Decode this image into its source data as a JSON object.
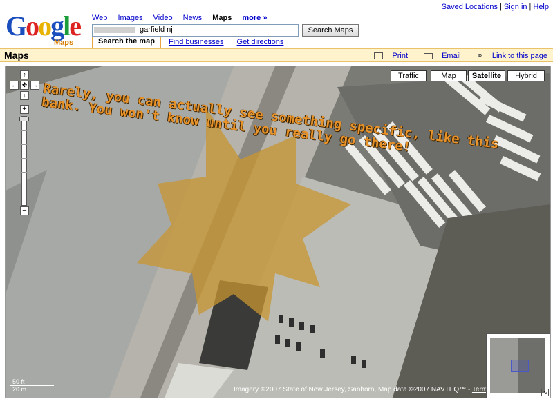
{
  "header": {
    "top_links": [
      "Saved Locations",
      "Sign in",
      "Help"
    ],
    "logo_text": "Google",
    "logo_sub": "Maps",
    "nav": [
      {
        "label": "Web",
        "active": false
      },
      {
        "label": "Images",
        "active": false
      },
      {
        "label": "Video",
        "active": false
      },
      {
        "label": "News",
        "active": false
      },
      {
        "label": "Maps",
        "active": true
      },
      {
        "label": "more »",
        "active": false
      }
    ],
    "search_value": "garfield nj",
    "search_button": "Search Maps",
    "subtabs": [
      {
        "label": "Search the map",
        "active": true
      },
      {
        "label": "Find businesses",
        "active": false
      },
      {
        "label": "Get directions",
        "active": false
      }
    ]
  },
  "bar": {
    "title": "Maps",
    "print": "Print",
    "email": "Email",
    "link": "Link to this page"
  },
  "map": {
    "types": [
      "Traffic",
      "Map",
      "Satellite",
      "Hybrid"
    ],
    "active_type": "Satellite",
    "pan": {
      "up": "↑",
      "left": "←",
      "center": "✥",
      "right": "→",
      "down": "↓"
    },
    "zoom_in": "+",
    "zoom_out": "−",
    "overlay_text": "Rarely, you can actually see something specific, like this bank. You won't know until you really go there!",
    "scale_ft": "50 ft",
    "scale_m": "20 m",
    "copyright": "Imagery ©2007 State of New Jersey, Sanborn, Map data ©2007 NAVTEQ™ - ",
    "terms": "Terms of Use",
    "overview_toggle": "↘"
  },
  "colors": {
    "accent": "#e8a440",
    "bar_bg": "#fff3cd",
    "overlay_text": "#e8932a",
    "star": "#c89530"
  }
}
